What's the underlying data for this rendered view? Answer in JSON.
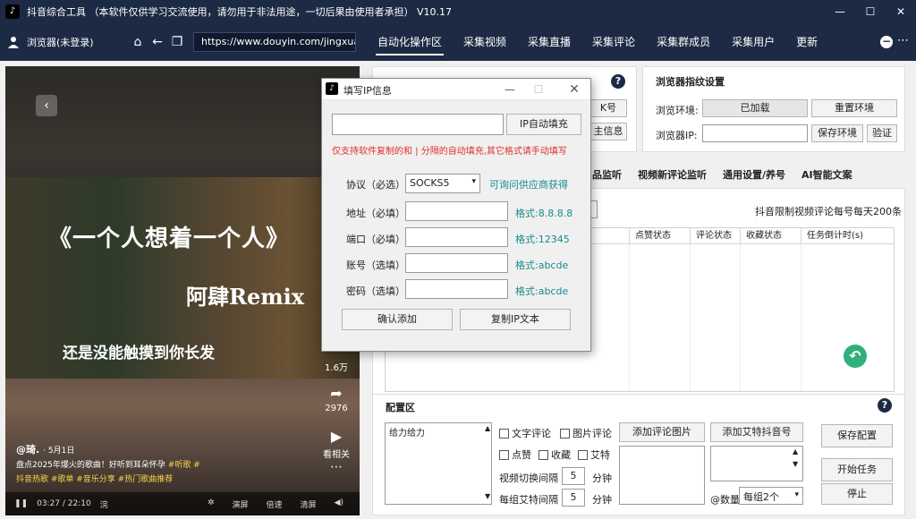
{
  "window": {
    "title": "抖音综合工具 （本软件仅供学习交流使用，请勿用于非法用途，一切后果由使用者承担） V10.17",
    "app_icon": "tiktok-icon"
  },
  "menubar": {
    "user_label": "浏览器(未登录)",
    "url": "https://www.douyin.com/jingxuan",
    "tabs": [
      "自动化操作区",
      "采集视频",
      "采集直播",
      "采集评论",
      "采集群成员",
      "采集用户",
      "更新"
    ],
    "active_tab": 0
  },
  "video": {
    "title_text": "《一个人想着一个人》",
    "remix_text": "阿肆Remix",
    "lyric_text": "还是没能触摸到你长发",
    "like_count": "1.6万",
    "share_count": "2976",
    "play_label": "看相关",
    "author": "@琦.",
    "date": "· 5月1日",
    "desc": "盘点2025年爆火的歌曲！好听到耳朵怀孕",
    "desc_tags": "#听歌 #",
    "tags_line": "抖音热歌 #歌单 #音乐分享 #热门歌曲推荐",
    "time": "03:27 / 22:10",
    "speed_label": "浣",
    "controls_right": [
      "演屏",
      "倍速",
      "清屏"
    ]
  },
  "top_left_panel": {
    "btn_top": "K号",
    "btn_bottom": "主信息"
  },
  "fingerprint": {
    "title": "浏览器指纹设置",
    "env_label": "浏览环境:",
    "env_status": "已加载",
    "reset_btn": "重置环境",
    "ip_label": "浏览器IP:",
    "ip_value": "",
    "save_btn": "保存环境",
    "verify_btn": "验证"
  },
  "subtabs": [
    "品监听",
    "视频新评论监听",
    "通用设置/养号",
    "AI智能文案"
  ],
  "limit_note": "抖音限制视频评论每号每天200条",
  "table": {
    "headers": [
      "点赞状态",
      "评论状态",
      "收藏状态",
      "任务倒计时(s)"
    ]
  },
  "config": {
    "title": "配置区",
    "textarea_value": "给力给力",
    "cb_text_comment": "文字评论",
    "cb_image_comment": "图片评论",
    "add_comment_image_btn": "添加评论图片",
    "add_mention_btn": "添加艾特抖音号",
    "save_config_btn": "保存配置",
    "cb_like": "点赞",
    "cb_collect": "收藏",
    "cb_mention": "艾特",
    "switch_interval_label": "视频切换间隔",
    "switch_interval_value": "5",
    "unit_sec": "分钟",
    "mention_interval_label": "每组艾特间隔",
    "mention_interval_value": "5",
    "count_label": "@数量",
    "count_value": "每组2个",
    "start_btn": "开始任务",
    "stop_btn": "停止"
  },
  "dialog": {
    "title": "填写IP信息",
    "auto_fill_btn": "IP自动填充",
    "hint": "仅支持软件复制的和 | 分隔的自动填充,其它格式请手动填写",
    "protocol_label": "协议（必选）",
    "protocol_value": "SOCKS5",
    "protocol_hint": "可询问供应商获得",
    "address_label": "地址（必填）",
    "address_fmt": "格式:8.8.8.8",
    "port_label": "端口（必填）",
    "port_fmt": "格式:12345",
    "account_label": "账号（选填）",
    "account_fmt": "格式:abcde",
    "password_label": "密码（选填）",
    "password_fmt": "格式:abcde",
    "confirm_btn": "确认添加",
    "copy_btn": "复制IP文本"
  }
}
